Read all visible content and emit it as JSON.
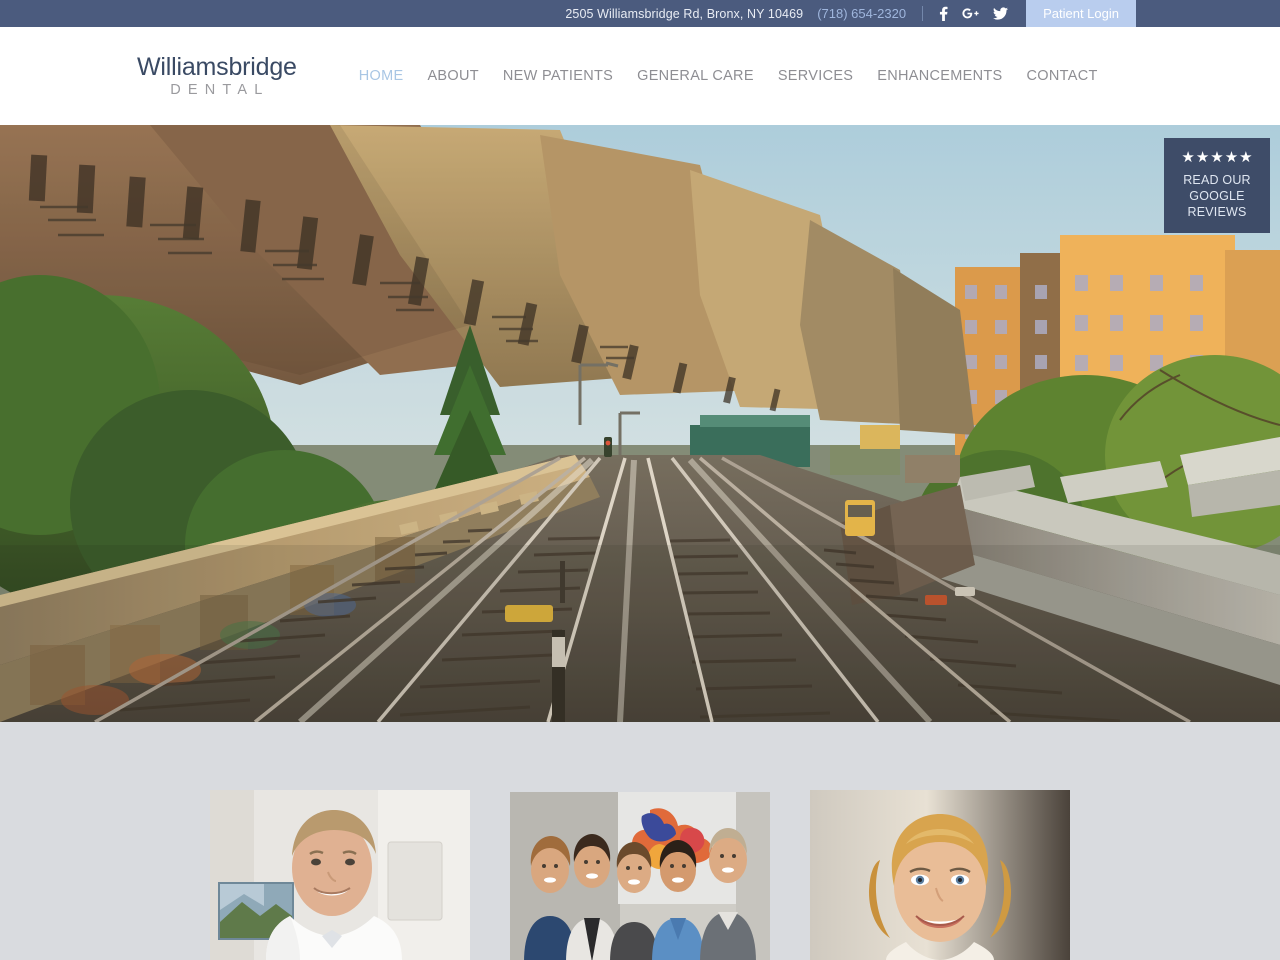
{
  "topbar": {
    "address": "2505 Williamsbridge Rd, Bronx, NY 10469",
    "phone": "(718) 654-2320",
    "social": [
      {
        "name": "facebook-icon",
        "label": "Facebook"
      },
      {
        "name": "google-plus-icon",
        "label": "Google Plus"
      },
      {
        "name": "twitter-icon",
        "label": "Twitter"
      }
    ],
    "patient_login_label": "Patient Login",
    "bg_color": "#4b5b7e",
    "phone_color": "#9fb6dd",
    "login_bg_color": "#b9cdee"
  },
  "header": {
    "logo_main": "Williamsbridge",
    "logo_sub": "DENTAL",
    "logo_main_color": "#3a4a64",
    "logo_sub_color": "#9a9a9e",
    "nav": [
      {
        "label": "HOME",
        "active": true
      },
      {
        "label": "ABOUT",
        "active": false
      },
      {
        "label": "NEW PATIENTS",
        "active": false
      },
      {
        "label": "GENERAL CARE",
        "active": false
      },
      {
        "label": "SERVICES",
        "active": false
      },
      {
        "label": "ENHANCEMENTS",
        "active": false
      },
      {
        "label": "CONTACT",
        "active": false
      }
    ],
    "nav_color": "#8e8e93",
    "nav_active_color": "#a9c6e4"
  },
  "hero": {
    "alt": "Elevated subway tracks running through a Bronx neighborhood at golden hour with brownstone apartment buildings and trees",
    "badge": {
      "stars": 5,
      "star_glyph": "★",
      "line1": "READ OUR",
      "line2": "GOOGLE",
      "line3": "REVIEWS",
      "bg_color": "#3e4c68"
    }
  },
  "gallery": {
    "bg_color": "#d9dbdf",
    "cards": [
      {
        "name": "gallery-card-dentist-portrait",
        "alt": "Portrait of a smiling male dentist in a white coat"
      },
      {
        "name": "gallery-card-team-photo",
        "alt": "Dental team of five staff members posing in the office"
      },
      {
        "name": "gallery-card-patient-smile",
        "alt": "Close-up of a smiling blonde woman patient"
      }
    ]
  }
}
